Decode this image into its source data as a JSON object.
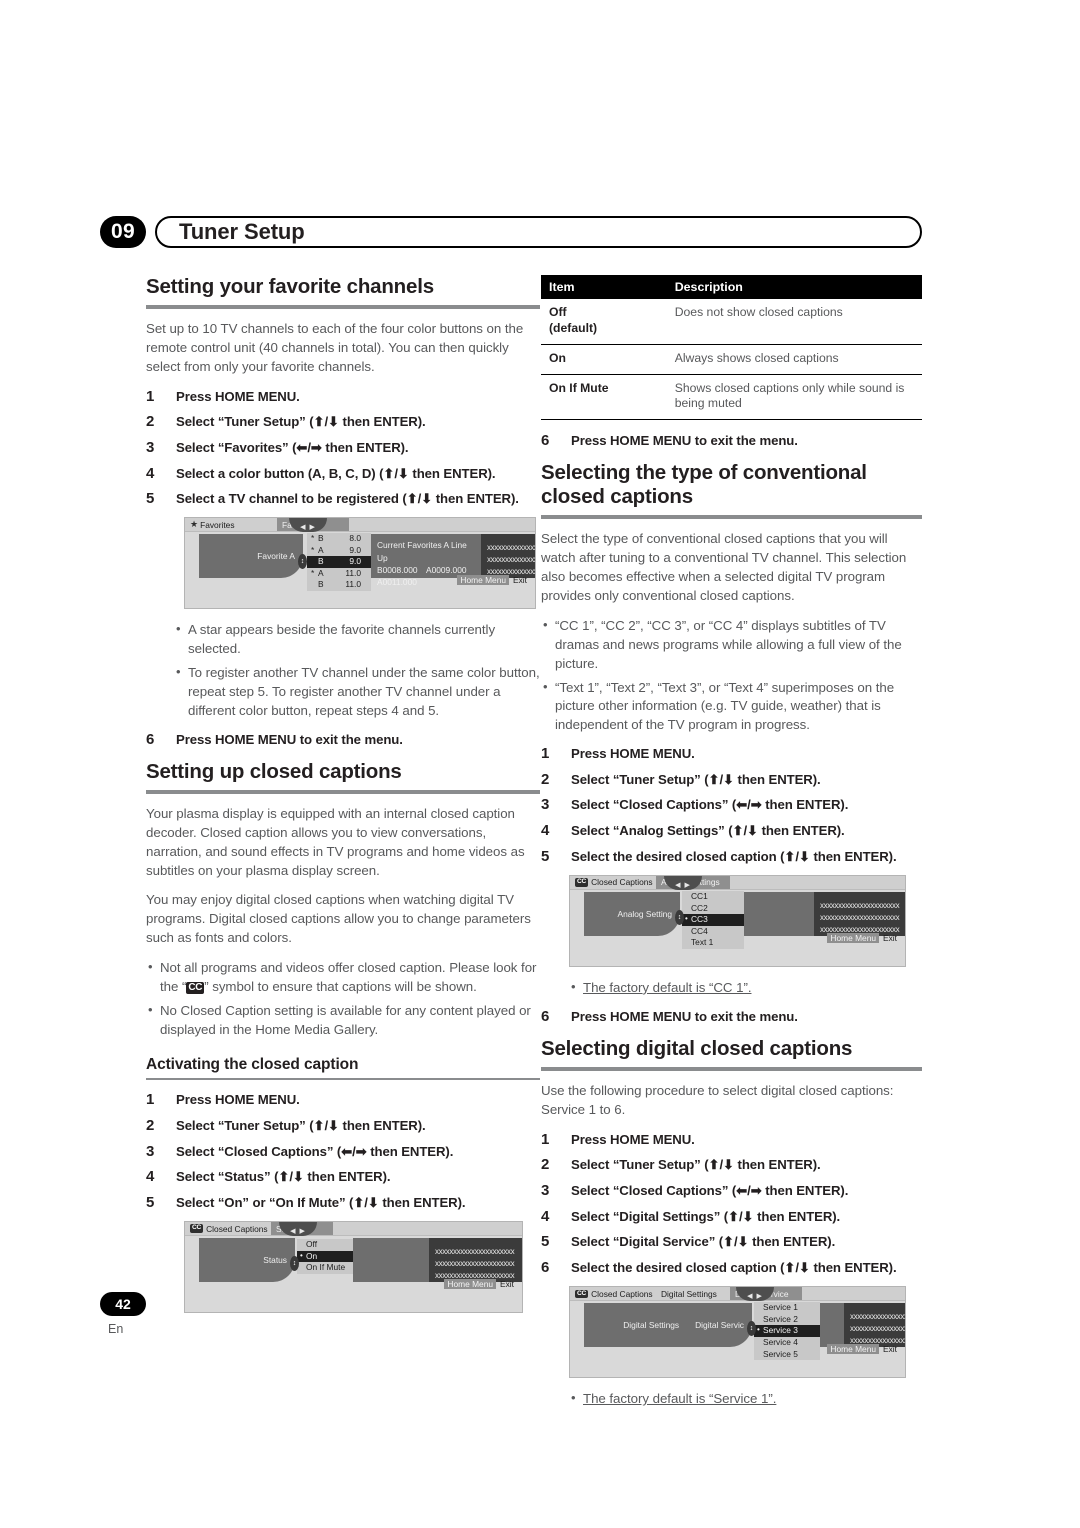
{
  "header": {
    "chapter_number": "09",
    "chapter_title": "Tuner Setup"
  },
  "footer": {
    "page_number": "42",
    "language": "En"
  },
  "left_column": {
    "section1": {
      "heading": "Setting your favorite channels",
      "intro": "Set up to 10 TV channels to each of the four color buttons on the remote control unit (40 channels in total). You can then quickly select from only your favorite channels.",
      "steps": [
        {
          "num": "1",
          "text": "Press HOME MENU."
        },
        {
          "num": "2",
          "text": "Select “Tuner Setup” (⬆/⬇ then ENTER)."
        },
        {
          "num": "3",
          "text": "Select “Favorites” (⬅/➡ then ENTER)."
        },
        {
          "num": "4",
          "text": "Select a color button (A, B, C, D) (⬆/⬇ then ENTER)."
        },
        {
          "num": "5",
          "text": "Select a TV channel to be registered (⬆/⬇ then ENTER)."
        }
      ],
      "notes": [
        "A star appears beside the favorite channels currently selected.",
        "To register another TV channel under the same color button, repeat step 5. To register another TV channel under a different color button, repeat steps 4 and 5."
      ],
      "final_step": {
        "num": "6",
        "text": "Press HOME MENU to exit the menu."
      },
      "osd": {
        "tab_home": "Favorites",
        "tab_active": "Favorite A",
        "left_label": "Favorite A",
        "nav_glyph": "◀ ▶",
        "channel_rows": [
          {
            "star": "*",
            "letter": "B",
            "number": "8.0",
            "selected": false
          },
          {
            "star": "*",
            "letter": "A",
            "number": "9.0",
            "selected": false
          },
          {
            "star": "",
            "letter": "B",
            "number": "9.0",
            "selected": true
          },
          {
            "star": "*",
            "letter": "A",
            "number": "11.0",
            "selected": false
          },
          {
            "star": "",
            "letter": "B",
            "number": "11.0",
            "selected": false
          }
        ],
        "info_title": "Current Favorites A Line Up",
        "info_line2_a": "B0008.000",
        "info_line2_b": "A0009.000",
        "info_line3": "A0011.000",
        "x_lines": [
          "xxxxxxxxxxxxxxxxxxxxx",
          "xxxxxxxxxxxxxxxxxxxxx",
          "xxxxxxxxxxxxxxxxxxxxx"
        ],
        "footer_home": "Home Menu",
        "footer_exit": "Exit"
      }
    },
    "section2": {
      "heading": "Setting up closed captions",
      "para1": "Your plasma display is equipped with an internal closed caption decoder. Closed caption allows you to view conversations, narration, and sound effects in TV programs and home videos as subtitles on your plasma display screen.",
      "para2": "You may enjoy digital closed captions when watching digital TV programs. Digital closed captions allow you to change parameters such as fonts and colors.",
      "note1_a": "Not all programs and videos offer closed caption. Please look for the “",
      "note1_badge": "CC",
      "note1_b": "” symbol to ensure that captions will be shown.",
      "note2": "No Closed Caption setting is available for any content played or displayed in the Home Media Gallery."
    },
    "section3": {
      "heading": "Activating the closed caption",
      "steps": [
        {
          "num": "1",
          "text": "Press HOME MENU."
        },
        {
          "num": "2",
          "text": "Select “Tuner Setup” (⬆/⬇ then ENTER)."
        },
        {
          "num": "3",
          "text": "Select “Closed Captions” (⬅/➡ then ENTER)."
        },
        {
          "num": "4",
          "text": "Select “Status” (⬆/⬇ then ENTER)."
        },
        {
          "num": "5",
          "text": "Select “On” or “On If Mute” (⬆/⬇ then ENTER)."
        }
      ],
      "osd": {
        "badge": "CC",
        "tab_home": "Closed Captions",
        "tab_active": "Status",
        "left_label": "Status",
        "nav_glyph": "◀ ▶",
        "options": [
          {
            "label": "Off",
            "selected": false
          },
          {
            "label": "On",
            "selected": true
          },
          {
            "label": "On If Mute",
            "selected": false
          }
        ],
        "x_lines": [
          "xxxxxxxxxxxxxxxxxxxxxx",
          "xxxxxxxxxxxxxxxxxxxxxx",
          "xxxxxxxxxxxxxxxxxxxxxx"
        ],
        "footer_home": "Home Menu",
        "footer_exit": "Exit"
      }
    }
  },
  "right_column": {
    "table": {
      "columns": [
        "Item",
        "Description"
      ],
      "rows": [
        {
          "item": "Off\n(default)",
          "desc": "Does not show closed captions"
        },
        {
          "item": "On",
          "desc": "Always shows closed captions"
        },
        {
          "item": "On If Mute",
          "desc": "Shows closed captions only while sound is being muted"
        }
      ]
    },
    "step6_a": {
      "num": "6",
      "text": "Press HOME MENU to exit the menu."
    },
    "section4": {
      "heading": "Selecting the type of conventional closed captions",
      "intro": "Select the type of conventional closed captions that you will watch after tuning to a conventional TV channel. This selection also becomes effective when a selected digital TV program provides only conventional closed captions.",
      "notes": [
        "“CC 1”, “CC 2”, “CC 3”, or “CC 4” displays subtitles of TV dramas and news programs while allowing a full view of the picture.",
        "“Text 1”, “Text 2”, “Text 3”, or “Text 4” superimposes on the picture other information (e.g. TV guide, weather) that is independent of the TV program in progress."
      ],
      "steps": [
        {
          "num": "1",
          "text": "Press HOME MENU."
        },
        {
          "num": "2",
          "text": "Select “Tuner Setup” (⬆/⬇ then ENTER)."
        },
        {
          "num": "3",
          "text": "Select “Closed Captions” (⬅/➡ then ENTER)."
        },
        {
          "num": "4",
          "text": "Select “Analog Settings” (⬆/⬇ then ENTER)."
        },
        {
          "num": "5",
          "text": "Select the desired closed caption (⬆/⬇ then ENTER)."
        }
      ],
      "osd": {
        "badge": "CC",
        "tab_home": "Closed Captions",
        "tab_active": "Analog Settings",
        "left_label": "Analog Setting",
        "nav_glyph": "◀ ▶",
        "options": [
          {
            "label": "CC1",
            "selected": false
          },
          {
            "label": "CC2",
            "selected": false
          },
          {
            "label": "CC3",
            "selected": true
          },
          {
            "label": "CC4",
            "selected": false
          },
          {
            "label": "Text 1",
            "selected": false
          }
        ],
        "x_lines": [
          "xxxxxxxxxxxxxxxxxxxxxx",
          "xxxxxxxxxxxxxxxxxxxxxx",
          "xxxxxxxxxxxxxxxxxxxxxx"
        ],
        "footer_home": "Home Menu",
        "footer_exit": "Exit"
      },
      "default_note": "The factory default is “CC 1”.",
      "final_step": {
        "num": "6",
        "text": "Press HOME MENU to exit the menu."
      }
    },
    "section5": {
      "heading": "Selecting digital closed captions",
      "intro": "Use the following procedure to select digital closed captions: Service 1 to 6.",
      "steps": [
        {
          "num": "1",
          "text": "Press HOME MENU."
        },
        {
          "num": "2",
          "text": "Select “Tuner Setup” (⬆/⬇ then ENTER)."
        },
        {
          "num": "3",
          "text": "Select “Closed Captions” (⬅/➡ then ENTER)."
        },
        {
          "num": "4",
          "text": "Select “Digital Settings” (⬆/⬇ then ENTER)."
        },
        {
          "num": "5",
          "text": "Select “Digital Service” (⬆/⬇ then ENTER)."
        },
        {
          "num": "6",
          "text": "Select the desired closed caption (⬆/⬇ then ENTER)."
        }
      ],
      "osd": {
        "badge": "CC",
        "tab_home": "Closed Captions",
        "tab_mid": "Digital Settings",
        "tab_active": "Digital Service",
        "left_label": "Digital Settings",
        "mid_label": "Digital Servic",
        "nav_glyph": "◀ ▶",
        "options": [
          {
            "label": "Service 1",
            "selected": false
          },
          {
            "label": "Service 2",
            "selected": false
          },
          {
            "label": "Service 3",
            "selected": true
          },
          {
            "label": "Service 4",
            "selected": false
          },
          {
            "label": "Service 5",
            "selected": false
          }
        ],
        "x_lines": [
          "xxxxxxxxxxxxxxxxxxxxxx",
          "xxxxxxxxxxxxxxxxxxxxxx",
          "xxxxxxxxxxxxxxxxxxxxxx"
        ],
        "footer_home": "Home Menu",
        "footer_exit": "Exit"
      },
      "default_note": "The factory default is “Service 1”."
    }
  }
}
